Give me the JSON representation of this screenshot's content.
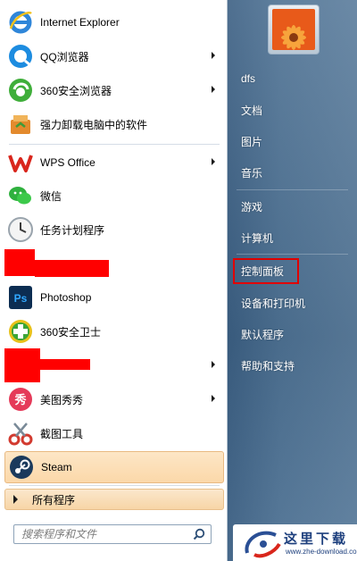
{
  "programs": [
    {
      "label": "Internet Explorer",
      "icon": "internet-explorer-icon",
      "arrow": false
    },
    {
      "label": "QQ浏览器",
      "icon": "qq-browser-icon",
      "arrow": true
    },
    {
      "label": "360安全浏览器",
      "icon": "360-browser-icon",
      "arrow": true
    },
    {
      "label": "强力卸载电脑中的软件",
      "icon": "uninstaller-icon",
      "arrow": false
    },
    {
      "label": "WPS Office",
      "icon": "wps-office-icon",
      "arrow": true
    },
    {
      "label": "微信",
      "icon": "wechat-icon",
      "arrow": false
    },
    {
      "label": "任务计划程序",
      "icon": "task-scheduler-icon",
      "arrow": false
    },
    {
      "label": "",
      "icon": "redacted-icon",
      "arrow": false
    },
    {
      "label": "Photoshop",
      "icon": "photoshop-icon",
      "arrow": false
    },
    {
      "label": "360安全卫士",
      "icon": "360-safeguard-icon",
      "arrow": false
    },
    {
      "label": "",
      "icon": "redacted-icon",
      "arrow": true
    },
    {
      "label": "美图秀秀",
      "icon": "meitu-icon",
      "arrow": true
    },
    {
      "label": "截图工具",
      "icon": "snipping-tool-icon",
      "arrow": false
    },
    {
      "label": "Steam",
      "icon": "steam-icon",
      "arrow": false
    }
  ],
  "all_programs": {
    "label": "所有程序"
  },
  "search": {
    "placeholder": "搜索程序和文件"
  },
  "right_menu": {
    "user": "dfs",
    "documents": "文档",
    "pictures": "图片",
    "music": "音乐",
    "games": "游戏",
    "computer": "计算机",
    "control_panel": "控制面板",
    "devices_printers": "设备和打印机",
    "default_programs": "默认程序",
    "help_support": "帮助和支持"
  },
  "watermark": {
    "title": "这里下载",
    "url": "www.zhe-download.com"
  },
  "colors": {
    "redaction": "#ff0000",
    "highlight": "#e00000",
    "right_pane": "#4d7193",
    "steam_highlight": "#fbd8a9"
  }
}
